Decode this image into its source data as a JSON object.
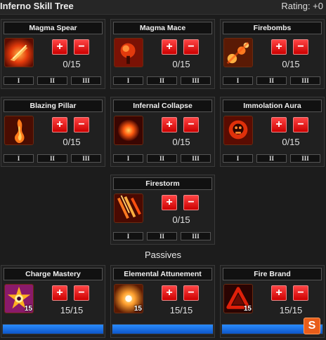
{
  "header": {
    "title": "Inferno Skill Tree",
    "rating": "Rating: +0"
  },
  "plus_symbol": "+",
  "minus_symbol": "−",
  "tiers": [
    "I",
    "II",
    "III"
  ],
  "skills": [
    {
      "name": "Magma Spear",
      "points": "0/15",
      "icon": "magma-spear-icon"
    },
    {
      "name": "Magma Mace",
      "points": "0/15",
      "icon": "magma-mace-icon"
    },
    {
      "name": "Firebombs",
      "points": "0/15",
      "icon": "firebombs-icon"
    },
    {
      "name": "Blazing Pillar",
      "points": "0/15",
      "icon": "blazing-pillar-icon"
    },
    {
      "name": "Infernal Collapse",
      "points": "0/15",
      "icon": "infernal-collapse-icon"
    },
    {
      "name": "Immolation Aura",
      "points": "0/15",
      "icon": "immolation-aura-icon"
    },
    {
      "name": "Firestorm",
      "points": "0/15",
      "icon": "firestorm-icon"
    }
  ],
  "passives_label": "Passives",
  "passives": [
    {
      "name": "Charge Mastery",
      "points": "15/15",
      "level": "15",
      "progress": 1.0,
      "icon": "charge-mastery-icon"
    },
    {
      "name": "Elemental Attunement",
      "points": "15/15",
      "level": "15",
      "progress": 1.0,
      "icon": "elemental-attunement-icon"
    },
    {
      "name": "Fire Brand",
      "points": "15/15",
      "level": "15",
      "progress": 1.0,
      "icon": "fire-brand-icon"
    }
  ],
  "colors": {
    "accent_red": "#e01010",
    "progress_blue": "#1f78f0",
    "icon_border": "#6b2a10"
  },
  "corner_logo": "S"
}
